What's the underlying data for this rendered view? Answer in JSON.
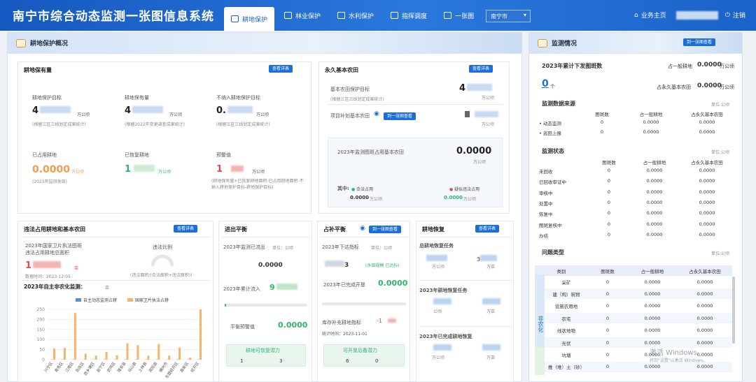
{
  "header": {
    "title": "南宁市综合动态监测一张图信息系统",
    "nav": [
      {
        "label": "耕地保护",
        "active": true
      },
      {
        "label": "林业保护"
      },
      {
        "label": "水利保护"
      },
      {
        "label": "指挥调度"
      },
      {
        "label": "一张图"
      }
    ],
    "city": "南宁市",
    "home": "业务主页",
    "logout": "注销"
  },
  "left": {
    "title": "耕地保护概况",
    "detail_btn": "查看详表",
    "map_btn": "到一张图查看",
    "farmland": {
      "title": "耕地保有量",
      "target_label": "耕地保护目标",
      "target_val": "4",
      "target_unit": "万公顷",
      "target_note": "(根据三区三线划定成果统计)",
      "hold_label": "耕地保有量",
      "hold_val": "4",
      "hold_unit": "万公顷",
      "hold_note": "(根据2022年变更调查成果统计)",
      "excl_label": "不纳入耕地保护目标",
      "excl_val": "0.",
      "excl_unit": "万公顷",
      "excl_note": "(根据三区三线划定成果统计)",
      "used_label": "已占用耕地",
      "used_val": "0.0000",
      "used_unit": "万公顷",
      "used_note": "(2023年监测发现)",
      "rest_label": "已恢复耕地",
      "rest_val": "1",
      "rest_unit": "万公顷",
      "warn_label": "预警值",
      "warn_val": "1",
      "warn_unit": "万公顷",
      "warn_note": "(耕地保有量+已恢复耕地面积-已占用耕地面积-不纳入耕地保护目标-耕地保护目标)"
    },
    "basic": {
      "title": "永久基本农田",
      "target_label": "基本农田保护目标",
      "target_note": "(根据三区三线划定成果统计)",
      "target_val": "4",
      "target_unit": "万公顷",
      "proj_label": "项目补划基本农田",
      "proj_val": "",
      "proj_unit": "万公顷",
      "occ_label": "2023年监测图斑占用基本农田",
      "occ_val": "0.0000",
      "occ_unit": "万公顷",
      "among": "其中:",
      "legal": "合法占用",
      "illegal": "疑似违法占用",
      "legal_val": "0.0000",
      "illegal_val": "0.0000",
      "unit": "万公顷"
    },
    "illegal": {
      "title": "违法占用耕地和基本农田",
      "line1": "2023年国家卫片执法图斑",
      "line2": "违法占用耕地总面积",
      "val": "1",
      "unit": "亩",
      "data_time": "数据时间：2023-12-05",
      "ratio_label": "违法比例",
      "ratio_note": "(违法面积/(合法面积+违法面积))",
      "chart_title": "2023年自主非农化监测：",
      "chart_unit": "亩",
      "legend1": "自主动态监测占耕",
      "legend2": "国家卫片执法占耕"
    },
    "balance": {
      "title": "进出平衡",
      "out_label": "2023年监测已流出",
      "unit_label": "单位：公顷",
      "out_val": "0.0000",
      "in_label": "2023年累计流入",
      "in_val": "9",
      "warn_label": "平衡预警值",
      "warn_val": "0.0000",
      "box_label": "耕地可恢复潜力",
      "box_v1": "1",
      "box_v2": "3"
    },
    "supp": {
      "title": "占补平衡",
      "idx_label": "2023年下达指标",
      "unit_label": "单位：公顷",
      "idx_val": "3",
      "idx_note": "(水田规模 已达标)",
      "done_label": "2023年已完成开垦",
      "done_val": "0.0000",
      "stock_label": "库存补充耕地指标",
      "stock_val": "-1",
      "stat_time": "统计时间：2023-11-01",
      "box_label": "可开垦后备潜力",
      "box_v1": "6",
      "box_v2": "0"
    },
    "recov": {
      "title": "耕地恢复",
      "task_label": "总耕地恢复任务",
      "v1": "",
      "u1": "万公顷",
      "v2": "3",
      "u2": "万亩",
      "task23": "2023年耕地恢复任务",
      "u3": "公顷",
      "u4": "万亩",
      "done23": "2023年已完成耕地恢复",
      "u5": "万公顷",
      "u6": "万亩"
    }
  },
  "chart_data": {
    "type": "bar",
    "categories": [
      "兴宁区",
      "青秀区",
      "江南区",
      "良庆区",
      "西乡塘区",
      "邕宁区",
      "武鸣区",
      "隆安县",
      "马山县",
      "上林县",
      "宾阳县",
      "横州市",
      "东盟经开区",
      "高新区",
      "经开区"
    ],
    "series": [
      {
        "name": "自主动态监测占耕",
        "values": [
          1,
          1,
          1,
          1,
          1,
          1,
          1,
          1,
          1,
          1,
          1,
          1,
          1,
          1,
          1
        ]
      },
      {
        "name": "国家卫片执法占耕",
        "values": [
          55,
          58,
          232,
          30,
          20,
          38,
          22,
          82,
          72,
          20,
          78,
          20,
          60,
          10,
          250
        ]
      }
    ],
    "ylim": [
      0,
      250
    ],
    "legend_position": "top"
  },
  "right": {
    "title": "监测情况",
    "map_btn": "到一张图查看",
    "cum_label": "2023年累计下发图斑数",
    "cum_val": "0",
    "cum_unit": "个",
    "occ_farm_label": "占一般耕地",
    "occ_farm_val": "0.0000",
    "occ_basic_label": "占永久基本农田",
    "occ_basic_val": "0.0000",
    "ha": "万公顷",
    "src": {
      "title": "监测数据来源",
      "unit": "单位:公顷",
      "h": [
        "图斑数",
        "占一般耕地",
        "占永久基本农田"
      ],
      "rows": [
        {
          "n": "动态监测",
          "a": "0",
          "b": "0.0000",
          "c": "0.0000"
        },
        {
          "n": "巡田上报",
          "a": "0",
          "b": "0.0000",
          "c": "0.0000"
        }
      ]
    },
    "status": {
      "title": "监测状态",
      "unit": "单位:公顷",
      "h": [
        "图斑数",
        "占一般耕地",
        "占永久基本农田"
      ],
      "rows": [
        {
          "n": "未回收",
          "a": "0",
          "b": "0.0000",
          "c": "0.0000"
        },
        {
          "n": "已回收审证中",
          "a": "0",
          "b": "0.0000",
          "c": "0.0000"
        },
        {
          "n": "审核中",
          "a": "0",
          "b": "0.0000",
          "c": "0.0000"
        },
        {
          "n": "处置中",
          "a": "0",
          "b": "0.0000",
          "c": "0.0000"
        },
        {
          "n": "恢复中",
          "a": "0",
          "b": "0.0000",
          "c": "0.0000"
        },
        {
          "n": "图斑复核中",
          "a": "0",
          "b": "0.0000",
          "c": "0.0000"
        },
        {
          "n": "办结",
          "a": "0",
          "b": "0.0000",
          "c": "0.0000"
        }
      ]
    },
    "issue": {
      "title": "问题类型",
      "unit": "单位:公顷",
      "h": [
        "类别",
        "图斑数",
        "占一般耕地",
        "占永久基本农田"
      ],
      "cat": "非农化",
      "rows": [
        {
          "n": "采矿",
          "a": "0",
          "b": "0.0000",
          "c": "0.0000"
        },
        {
          "n": "建（构）筑物",
          "a": "0",
          "b": "0.0000",
          "c": "0.0000"
        },
        {
          "n": "设施农用地",
          "a": "0",
          "b": "0.0000",
          "c": "0.0000"
        },
        {
          "n": "农宅",
          "a": "0",
          "b": "0.0000",
          "c": "0.0000"
        },
        {
          "n": "线状地物",
          "a": "0",
          "b": "0.0000",
          "c": "0.0000"
        },
        {
          "n": "光伏",
          "a": "0",
          "b": "0.0000",
          "c": "0.0000"
        },
        {
          "n": "坑塘",
          "a": "0",
          "b": "0.0000",
          "c": "0.0000"
        },
        {
          "n": "推（堆）土（砂）",
          "a": "0",
          "b": "0.0000",
          "c": "0.0000"
        }
      ]
    },
    "watermark1": "激活 Windows",
    "watermark2": "转到\"设置\"以激活 Windows。"
  }
}
